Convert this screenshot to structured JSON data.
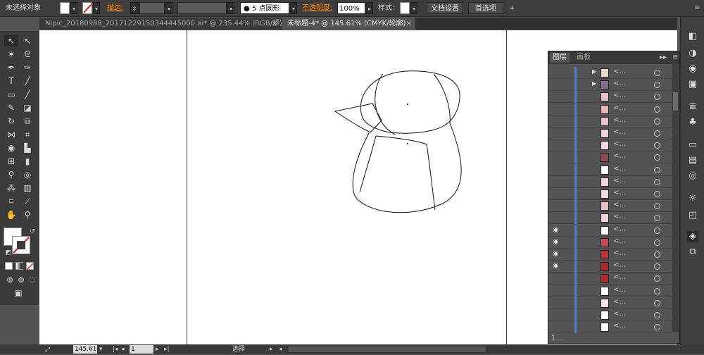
{
  "control_bar": {
    "selection_label": "未选择对象",
    "stroke_label": "描边:",
    "brush_value": "5 点圆形",
    "opacity_label": "不透明度:",
    "opacity_value": "100%",
    "style_label": "样式:",
    "doc_setup_button": "文档设置",
    "prefs_button": "首选项"
  },
  "tabs": [
    {
      "label": "Nipic_20180988_20171229150344445000.ai* @ 235.44% (RGB/预览)",
      "close": "×",
      "active": false
    },
    {
      "label": "未标题-4* @ 145.61% (CMYK/轮廓)",
      "close": "×",
      "active": true
    }
  ],
  "layers_panel": {
    "tabs": [
      "图层",
      "画板"
    ],
    "collapse_icon": "▸▸",
    "menu_icon": "≡",
    "item_name": "<...",
    "visible_rows": [
      13,
      14,
      15,
      16
    ],
    "expandable_rows": [
      0,
      1
    ],
    "thumb_colors": [
      "#e9d8c8",
      "#8a6a8f",
      "#eac1c8",
      "#e6b4bf",
      "#e9c3cb",
      "#efd3d8",
      "#f1d9de",
      "#8e4a55",
      "#ffffff",
      "#f4d7dc",
      "#f2dbe0",
      "#e8bfc6",
      "#f0d7dc",
      "#ffffff",
      "#c44b57",
      "#b8323e",
      "#a82a34",
      "#b02b37",
      "#ffffff",
      "#f6e6e8",
      "#ffffff",
      "#ffffff"
    ],
    "footer_count": "1 ..."
  },
  "status_bar": {
    "zoom": "145.61",
    "page": "1",
    "tool_label": "选择"
  },
  "colors": {
    "accent_orange": "#ff8a00",
    "layer_blue": "#4d7fd6"
  }
}
